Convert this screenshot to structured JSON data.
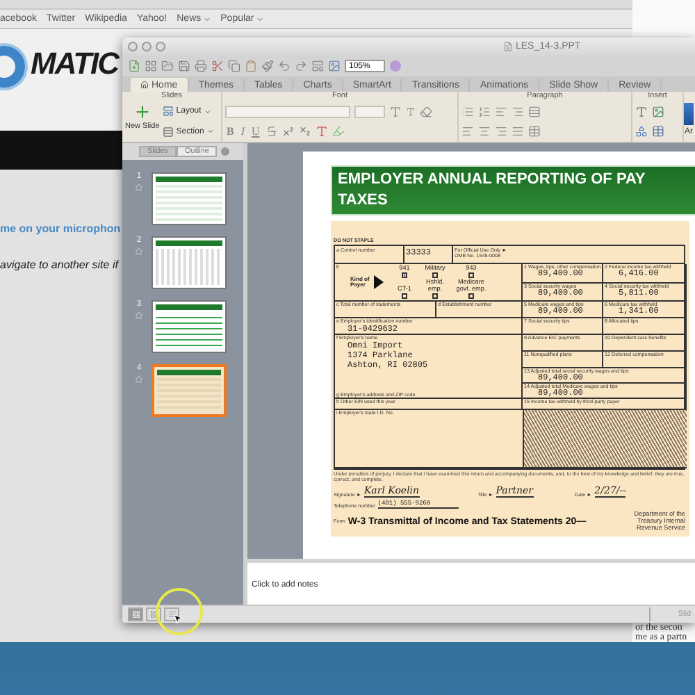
{
  "browser": {
    "bookmarks": [
      {
        "label": "acebook",
        "menu": false
      },
      {
        "label": "Twitter",
        "menu": false
      },
      {
        "label": "Wikipedia",
        "menu": false
      },
      {
        "label": "Yahoo!",
        "menu": false
      },
      {
        "label": "News",
        "menu": true
      },
      {
        "label": "Popular",
        "menu": true
      }
    ],
    "logo_text": "MATIC",
    "lines": [
      {
        "kind": "link",
        "text": "me on your microphon"
      },
      {
        "kind": "note",
        "text": "avigate to another site if"
      }
    ]
  },
  "back_window": {
    "lines": [
      "or the secon",
      "me as a partn"
    ]
  },
  "ppt": {
    "title": "LES_14-3.PPT",
    "zoom": "105%",
    "tabs": [
      {
        "label": "Home",
        "selected": true
      },
      {
        "label": "Themes",
        "selected": false
      },
      {
        "label": "Tables",
        "selected": false
      },
      {
        "label": "Charts",
        "selected": false
      },
      {
        "label": "SmartArt",
        "selected": false
      },
      {
        "label": "Transitions",
        "selected": false
      },
      {
        "label": "Animations",
        "selected": false
      },
      {
        "label": "Slide Show",
        "selected": false
      },
      {
        "label": "Review",
        "selected": false
      }
    ],
    "ribbon": {
      "groups": [
        "Slides",
        "Font",
        "Paragraph",
        "Insert"
      ],
      "new_slide": "New Slide",
      "layout": "Layout",
      "section": "Section",
      "format": [
        "B",
        "I",
        "U"
      ],
      "cut_label": "Ar"
    },
    "pane_tabs": [
      {
        "label": "Slides",
        "selected": true
      },
      {
        "label": "Outline",
        "selected": false
      }
    ],
    "thumbnails": [
      {
        "number": "1",
        "kind": "form",
        "selected": false
      },
      {
        "number": "2",
        "kind": "callouts",
        "selected": false
      },
      {
        "number": "3",
        "kind": "table",
        "selected": false
      },
      {
        "number": "4",
        "kind": "beige",
        "selected": true
      }
    ],
    "slide": {
      "title_lines": [
        "EMPLOYER ANNUAL REPORTING OF PAY",
        "TAXES"
      ],
      "form": {
        "staple": "DO NOT STAPLE",
        "control_label": "a Control number",
        "control_value": "33333",
        "official": "For Official Use Only ►",
        "omb": "OMB No. 1545-0008",
        "payer": {
          "marker": "b",
          "label": "Kind of Payer",
          "options": [
            {
              "label": "941",
              "checked": true
            },
            {
              "label": "Military",
              "checked": false
            },
            {
              "label": "943",
              "checked": false
            },
            {
              "label": "CT-1",
              "checked": false
            },
            {
              "label": "Hshld. emp.",
              "checked": false
            },
            {
              "label": "Medicare govt. emp.",
              "checked": false
            }
          ]
        },
        "boxes": [
          {
            "kind": "half",
            "label": "1 Wages, tips, other compensation",
            "value": "89,400.00"
          },
          {
            "kind": "half",
            "label": "2 Federal income tax withheld",
            "value": "6,416.00"
          },
          {
            "kind": "half",
            "label": "3 Social security wages",
            "value": "89,400.00"
          },
          {
            "kind": "half",
            "label": "4 Social security tax withheld",
            "value": "5,811.00"
          },
          {
            "kind": "half",
            "label": "5 Medicare wages and tips",
            "value": "89,400.00"
          },
          {
            "kind": "half",
            "label": "6 Medicare tax withheld",
            "value": "1,341.00"
          },
          {
            "kind": "half",
            "label": "7 Social security tips"
          },
          {
            "kind": "half",
            "label": "8 Allocated tips"
          },
          {
            "kind": "half",
            "label": "9 Advance EIC payments"
          },
          {
            "kind": "half",
            "label": "10 Dependent care benefits"
          },
          {
            "kind": "half",
            "label": "11 Nonqualified plans"
          },
          {
            "kind": "half",
            "label": "12 Deferred compensation"
          },
          {
            "kind": "wide",
            "label": "13 Adjusted total social security wages and tips",
            "value": "89,400.00"
          },
          {
            "kind": "wide",
            "label": "14 Adjusted total Medicare wages and tips",
            "value": "89,400.00"
          },
          {
            "kind": "wide",
            "label": "15 Income tax withheld by third-party payer"
          }
        ],
        "statements_label": "c Total number of statements",
        "establishment_label": "d Establishment number",
        "ein_label": "e Employer's identification number",
        "ein": "31-0429632",
        "name_label": "f Employer's name",
        "address_lines": [
          "Omni Import",
          "1374 Parklane",
          "Ashton, RI 02805"
        ],
        "address_label": "g Employer's address and ZIP code",
        "other_ein_label": "h Other EIN used this year",
        "state_id_label": "i Employer's state I.D. No.",
        "penalty": "Under penalties of perjury, I declare that I have examined this return and accompanying documents, and, to the best of my knowledge and belief, they are true, correct, and complete.",
        "signature_label": "Signature ►",
        "signature": "Karl Koelin",
        "title_label": "Title ►",
        "title": "Partner",
        "date_label": "Date ►",
        "date": "2/27/--",
        "phone_label": "Telephone number",
        "phone": "(401) 555-9268",
        "form_word": "Form",
        "form_title": "W-3 Transmittal of Income and Tax Statements 20—",
        "department": "Department of the Treasury Internal Revenue Service"
      }
    },
    "notes_placeholder": "Click to add notes",
    "status_text": "Slid"
  }
}
